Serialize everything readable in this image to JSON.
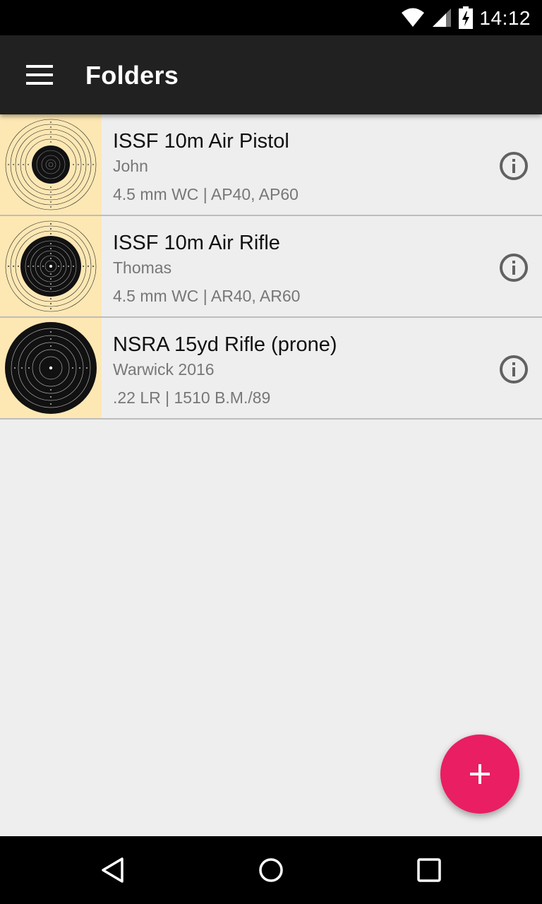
{
  "status_bar": {
    "time": "14:12",
    "icons": [
      "wifi-icon",
      "signal-icon",
      "battery-charging-icon"
    ]
  },
  "app_bar": {
    "title": "Folders",
    "menu_icon": "hamburger-menu-icon"
  },
  "folders": [
    {
      "name": "ISSF 10m Air Pistol",
      "owner": "John",
      "details": "4.5 mm WC | AP40, AP60",
      "thumbnail": "air-pistol-target-icon",
      "info_icon": "info-icon"
    },
    {
      "name": "ISSF 10m Air Rifle",
      "owner": "Thomas",
      "details": "4.5 mm WC | AR40, AR60",
      "thumbnail": "air-rifle-target-icon",
      "info_icon": "info-icon"
    },
    {
      "name": "NSRA 15yd Rifle (prone)",
      "owner": "Warwick 2016",
      "details": ".22 LR | 1510 B.M./89",
      "thumbnail": "nsra-rifle-target-icon",
      "info_icon": "info-icon"
    }
  ],
  "fab": {
    "icon": "plus-icon"
  },
  "nav_bar": {
    "icons": [
      "back-icon",
      "home-icon",
      "recents-icon"
    ]
  },
  "colors": {
    "app_bar": "#212121",
    "background": "#eeeeee",
    "accent": "#e91e63",
    "thumbnail_bg": "#fde8b4"
  }
}
